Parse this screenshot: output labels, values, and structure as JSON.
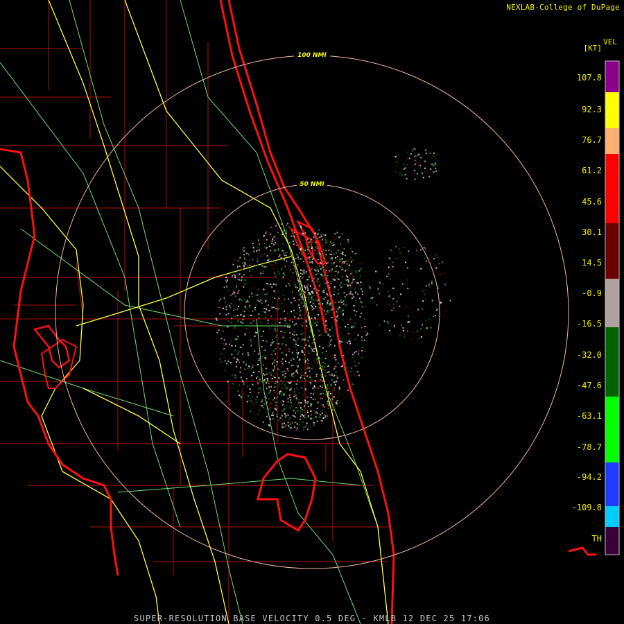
{
  "header": {
    "credit": "NEXLAB-College of DuPage"
  },
  "footer": {
    "product": "SUPER-RESOLUTION BASE VELOCITY 0.5 DEG - KMLB 12 DEC 25 17:06"
  },
  "range_rings": [
    {
      "label": "100 NMI"
    },
    {
      "label": "50 NMI"
    }
  ],
  "legend": {
    "title": "VEL",
    "unit": "[KT]",
    "ticks": [
      "107.8",
      "92.3",
      "76.7",
      "61.2",
      "45.6",
      "30.1",
      "14.5",
      "-0.9",
      "-16.5",
      "-32.0",
      "-47.6",
      "-63.1",
      "-78.7",
      "-94.2",
      "-109.8",
      "TH"
    ],
    "colors": {
      "purple": "#8a008a",
      "yellow": "#ffff00",
      "orange": "#ffb070",
      "red": "#ff0000",
      "dark_red": "#6a0000",
      "gray": "#b0a0a0",
      "dark_green": "#006400",
      "green": "#00ff00",
      "blue": "#1e3cff",
      "cyan": "#00ccff",
      "range_folded": "#3a003a"
    }
  },
  "map_colors": {
    "coastline": "#ff1010",
    "county_lines": "#b01010",
    "highways": "#ffff40",
    "roads": "#70e070",
    "range_ring": "#f0b8a0"
  }
}
